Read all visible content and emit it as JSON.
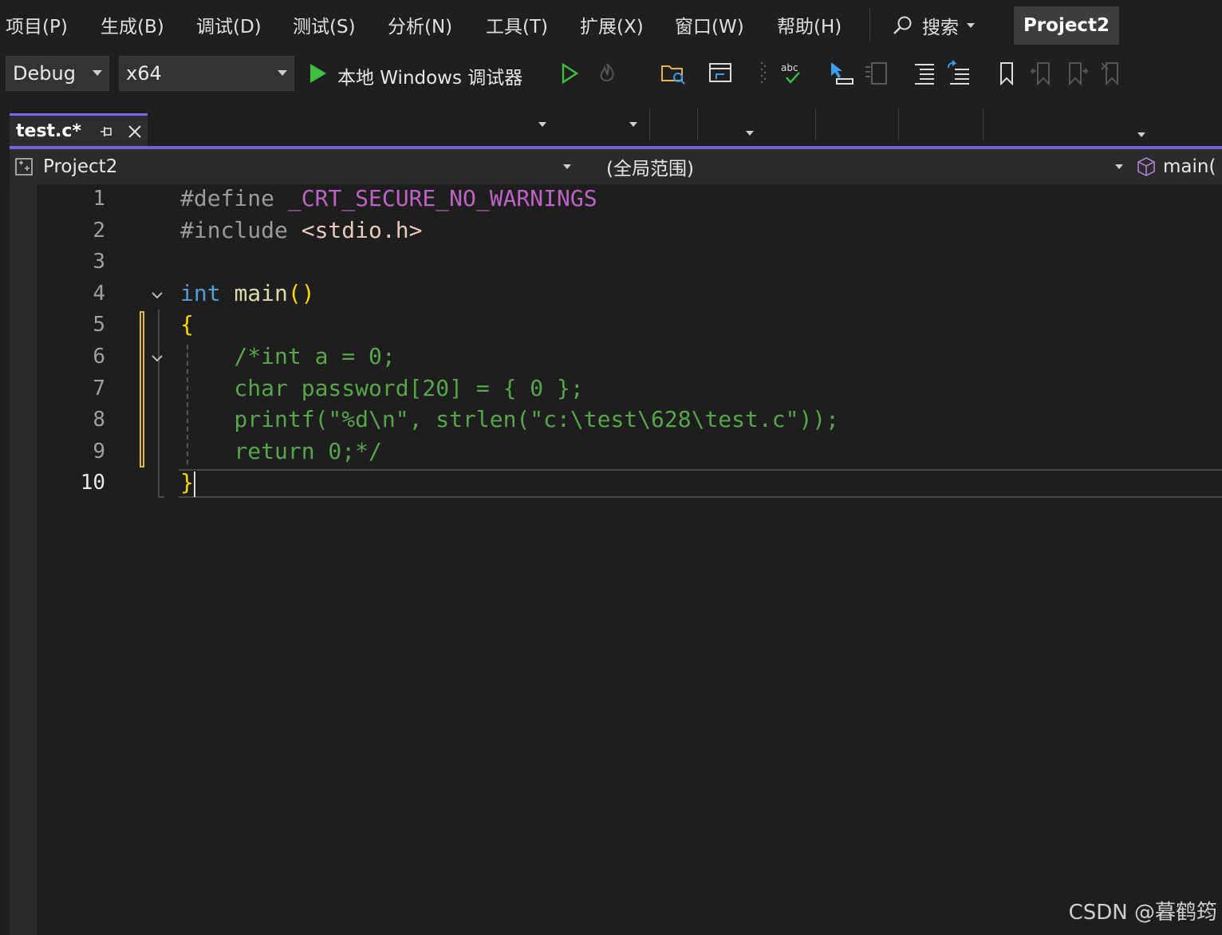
{
  "menu": {
    "items": [
      "项目(P)",
      "生成(B)",
      "调试(D)",
      "测试(S)",
      "分析(N)",
      "工具(T)",
      "扩展(X)",
      "窗口(W)",
      "帮助(H)"
    ],
    "search_label": "搜索",
    "project_name": "Project2"
  },
  "toolbar": {
    "configuration": "Debug",
    "platform": "x64",
    "debugger_label": "本地 Windows 调试器",
    "colors": {
      "play": "#3fbf3f",
      "folder": "#e8b24a",
      "accent": "#3a9fe8"
    }
  },
  "tab": {
    "title": "test.c*"
  },
  "navbar": {
    "project": "Project2",
    "scope": "(全局范围)",
    "member": "main("
  },
  "editor": {
    "current_line": 10,
    "lines": [
      {
        "num": "1",
        "tokens": [
          {
            "t": "#define ",
            "c": "c-pre"
          },
          {
            "t": "_CRT_SECURE_NO_WARNINGS",
            "c": "c-macro"
          }
        ]
      },
      {
        "num": "2",
        "tokens": [
          {
            "t": "#include ",
            "c": "c-pre"
          },
          {
            "t": "<stdio.h>",
            "c": "c-str"
          }
        ]
      },
      {
        "num": "3",
        "tokens": []
      },
      {
        "num": "4",
        "tokens": [
          {
            "t": "int",
            "c": "c-kw"
          },
          {
            "t": " ",
            "c": "c-pre"
          },
          {
            "t": "main",
            "c": "c-fn"
          },
          {
            "t": "()",
            "c": "c-paren"
          }
        ]
      },
      {
        "num": "5",
        "tokens": [
          {
            "t": "{",
            "c": "c-paren"
          }
        ]
      },
      {
        "num": "6",
        "tokens": [
          {
            "t": "    /*int a = 0;",
            "c": "c-comment"
          }
        ]
      },
      {
        "num": "7",
        "tokens": [
          {
            "t": "    char password[20] = { 0 };",
            "c": "c-comment"
          }
        ]
      },
      {
        "num": "8",
        "tokens": [
          {
            "t": "    printf(\"%d\\n\", strlen(\"c:\\test\\628\\test.c\"));",
            "c": "c-comment"
          }
        ]
      },
      {
        "num": "9",
        "tokens": [
          {
            "t": "    return 0;*/",
            "c": "c-comment"
          }
        ]
      },
      {
        "num": "10",
        "tokens": [
          {
            "t": "}",
            "c": "c-paren"
          }
        ]
      }
    ]
  },
  "watermark": "CSDN @暮鹤筠"
}
